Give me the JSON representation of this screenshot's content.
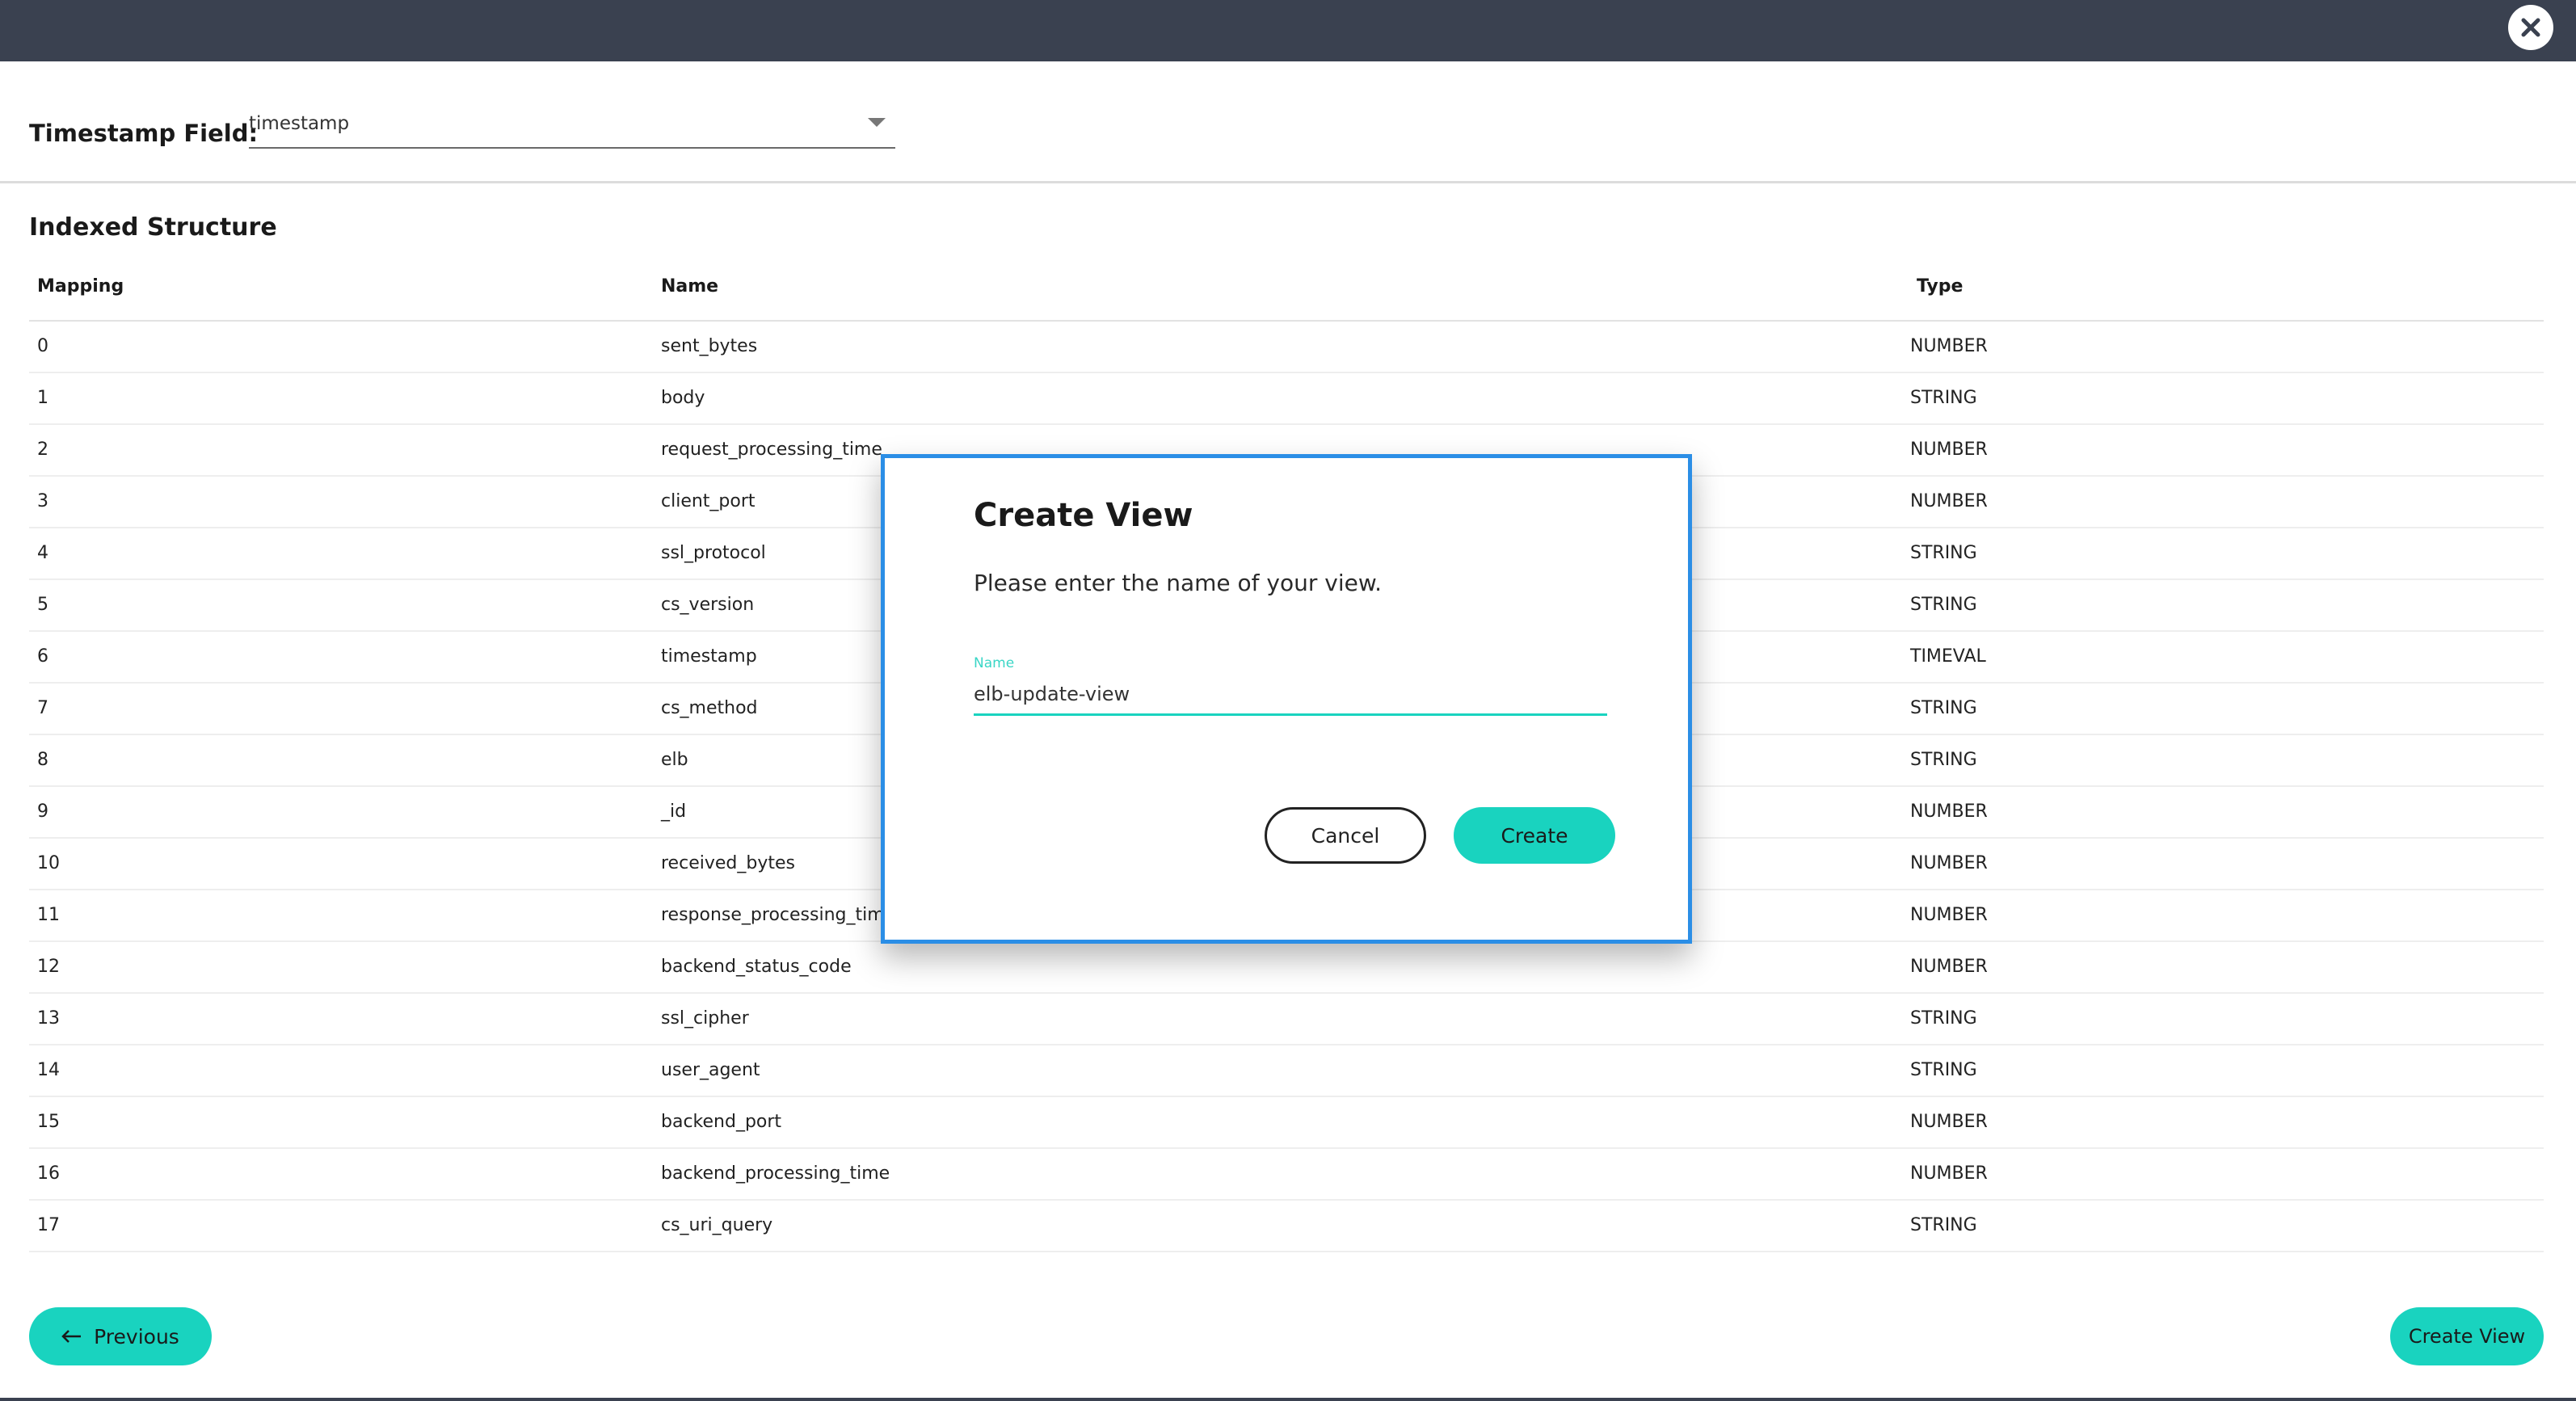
{
  "header": {
    "close_icon": "close-icon"
  },
  "timestamp_field": {
    "label": "Timestamp Field:",
    "selected": "timestamp"
  },
  "indexed_structure": {
    "title": "Indexed Structure",
    "columns": [
      "Mapping",
      "Name",
      "Type"
    ],
    "rows": [
      {
        "mapping": "0",
        "name": "sent_bytes",
        "type": "NUMBER"
      },
      {
        "mapping": "1",
        "name": "body",
        "type": "STRING"
      },
      {
        "mapping": "2",
        "name": "request_processing_time",
        "type": "NUMBER"
      },
      {
        "mapping": "3",
        "name": "client_port",
        "type": "NUMBER"
      },
      {
        "mapping": "4",
        "name": "ssl_protocol",
        "type": "STRING"
      },
      {
        "mapping": "5",
        "name": "cs_version",
        "type": "STRING"
      },
      {
        "mapping": "6",
        "name": "timestamp",
        "type": "TIMEVAL"
      },
      {
        "mapping": "7",
        "name": "cs_method",
        "type": "STRING"
      },
      {
        "mapping": "8",
        "name": "elb",
        "type": "STRING"
      },
      {
        "mapping": "9",
        "name": "_id",
        "type": "NUMBER"
      },
      {
        "mapping": "10",
        "name": "received_bytes",
        "type": "NUMBER"
      },
      {
        "mapping": "11",
        "name": "response_processing_time",
        "type": "NUMBER"
      },
      {
        "mapping": "12",
        "name": "backend_status_code",
        "type": "NUMBER"
      },
      {
        "mapping": "13",
        "name": "ssl_cipher",
        "type": "STRING"
      },
      {
        "mapping": "14",
        "name": "user_agent",
        "type": "STRING"
      },
      {
        "mapping": "15",
        "name": "backend_port",
        "type": "NUMBER"
      },
      {
        "mapping": "16",
        "name": "backend_processing_time",
        "type": "NUMBER"
      },
      {
        "mapping": "17",
        "name": "cs_uri_query",
        "type": "STRING"
      }
    ]
  },
  "modal": {
    "title": "Create View",
    "message": "Please enter the name of your view.",
    "field_label": "Name",
    "field_value": "elb-update-view",
    "cancel_label": "Cancel",
    "create_label": "Create"
  },
  "footer": {
    "previous_label": "Previous",
    "create_view_label": "Create View"
  },
  "colors": {
    "accent": "#19d3bf",
    "topbar": "#3a4150",
    "modal_border": "#2b8ee6"
  }
}
